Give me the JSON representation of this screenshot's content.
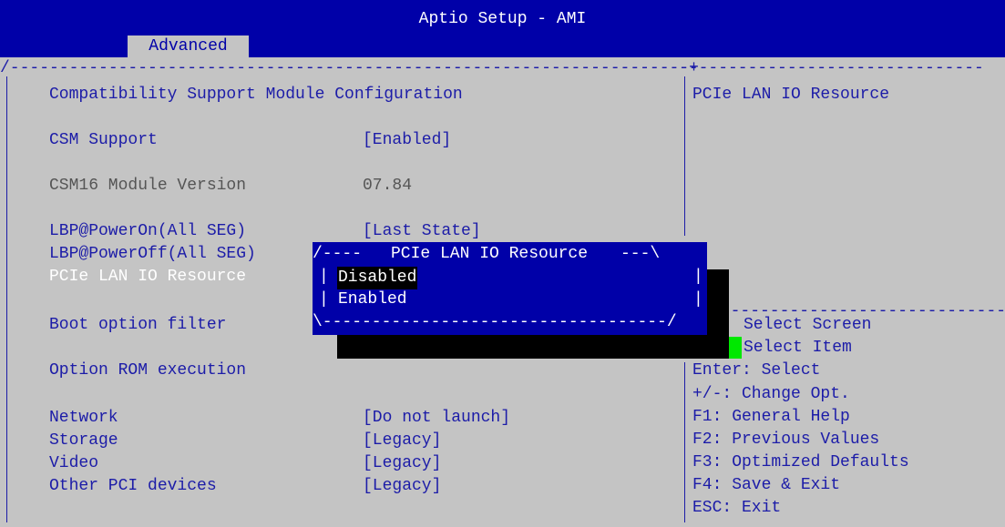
{
  "header": {
    "title": "Aptio Setup - AMI",
    "active_tab": "Advanced"
  },
  "main": {
    "section_title": "Compatibility Support Module Configuration",
    "settings": [
      {
        "label": "CSM Support",
        "value": "[Enabled]"
      },
      {
        "label": "CSM16 Module Version",
        "value": "07.84"
      },
      {
        "label": "LBP@PowerOn(All SEG)",
        "value": "[Last State]"
      },
      {
        "label": "LBP@PowerOff(All SEG)",
        "value": ""
      },
      {
        "label": "PCIe LAN IO Resource",
        "value": ""
      },
      {
        "label": "Boot option filter",
        "value": ""
      }
    ],
    "option_rom_heading": "Option ROM execution",
    "option_rom": [
      {
        "label": "Network",
        "value": "[Do not launch]"
      },
      {
        "label": "Storage",
        "value": "[Legacy]"
      },
      {
        "label": "Video",
        "value": "[Legacy]"
      },
      {
        "label": "Other PCI devices",
        "value": "[Legacy]"
      }
    ]
  },
  "help": {
    "description": "PCIe LAN IO Resource",
    "keys": [
      "Select Screen",
      "Select Item",
      "Enter: Select",
      "+/-: Change Opt.",
      "F1: General Help",
      "F2: Previous Values",
      "F3: Optimized Defaults",
      "F4: Save & Exit",
      "ESC: Exit"
    ]
  },
  "popup": {
    "title": "PCIe LAN IO Resource",
    "options": [
      "Disabled",
      "Enabled"
    ],
    "selected": "Disabled"
  },
  "colors": {
    "header_blue": "#0000a8",
    "text_blue": "#1c1ca8",
    "background_grey": "#c4c4c4",
    "cursor_green": "#00e800"
  }
}
